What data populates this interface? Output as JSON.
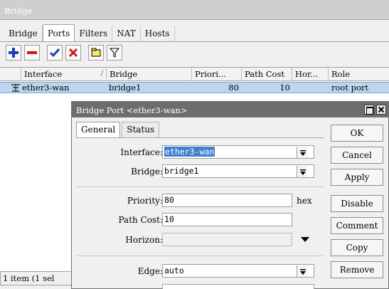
{
  "window": {
    "title": "Bridge"
  },
  "tabs": [
    "Bridge",
    "Ports",
    "Filters",
    "NAT",
    "Hosts"
  ],
  "active_tab": "Ports",
  "toolbar": {
    "icons": [
      "add-icon",
      "remove-icon",
      "enable-check-icon",
      "disable-x-icon",
      "comment-note-icon",
      "filter-icon"
    ]
  },
  "table": {
    "columns": [
      "Interface",
      "Bridge",
      "Priori...",
      "Path Cost",
      "Hor...",
      "Role"
    ],
    "rows": [
      {
        "interface": "ether3-wan",
        "bridge": "bridge1",
        "priority": "80",
        "path_cost": "10",
        "horizon": "",
        "role": "root port"
      }
    ]
  },
  "status": {
    "text": "1 item (1 sel"
  },
  "dialog": {
    "title": "Bridge Port <ether3-wan>",
    "tabs": [
      "General",
      "Status"
    ],
    "fields": {
      "interface": {
        "label": "Interface:",
        "value": "ether3-wan"
      },
      "bridge": {
        "label": "Bridge:",
        "value": "bridge1"
      },
      "priority": {
        "label": "Priority:",
        "value": "80",
        "unit": "hex"
      },
      "path_cost": {
        "label": "Path Cost:",
        "value": "10"
      },
      "horizon": {
        "label": "Horizon:",
        "value": ""
      },
      "edge": {
        "label": "Edge:",
        "value": "auto"
      }
    },
    "buttons": [
      "OK",
      "Cancel",
      "Apply",
      "Disable",
      "Comment",
      "Copy",
      "Remove"
    ]
  },
  "colors": {
    "selection": "#bdd5ee",
    "title_bar": "#6d6d6d",
    "input_selection": "#3d7fd0"
  }
}
